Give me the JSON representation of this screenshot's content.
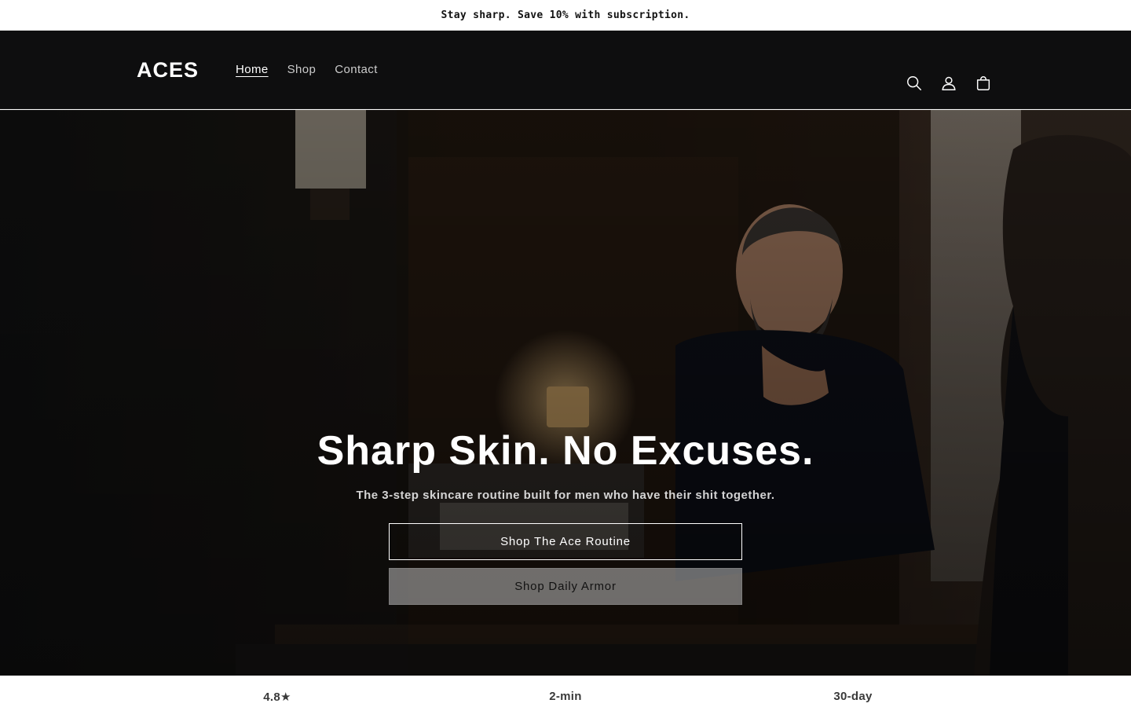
{
  "announcement": {
    "text": "Stay sharp. Save 10% with subscription."
  },
  "header": {
    "logo": "ACES",
    "nav": [
      {
        "label": "Home",
        "active": true
      },
      {
        "label": "Shop",
        "active": false
      },
      {
        "label": "Contact",
        "active": false
      }
    ],
    "icons": [
      "search-icon",
      "account-icon",
      "cart-icon"
    ]
  },
  "hero": {
    "title": "Sharp Skin. No Excuses.",
    "subtitle": "The 3-step skincare routine built for men who have their shit together.",
    "primary_button": "Shop The Ace Routine",
    "secondary_button": "Shop Daily Armor"
  },
  "stats": [
    "4.8★",
    "2-min",
    "30-day"
  ],
  "colors": {
    "header_bg": "#0e0e0f",
    "announcement_bg": "#ffffff",
    "hero_text": "#ffffff"
  }
}
